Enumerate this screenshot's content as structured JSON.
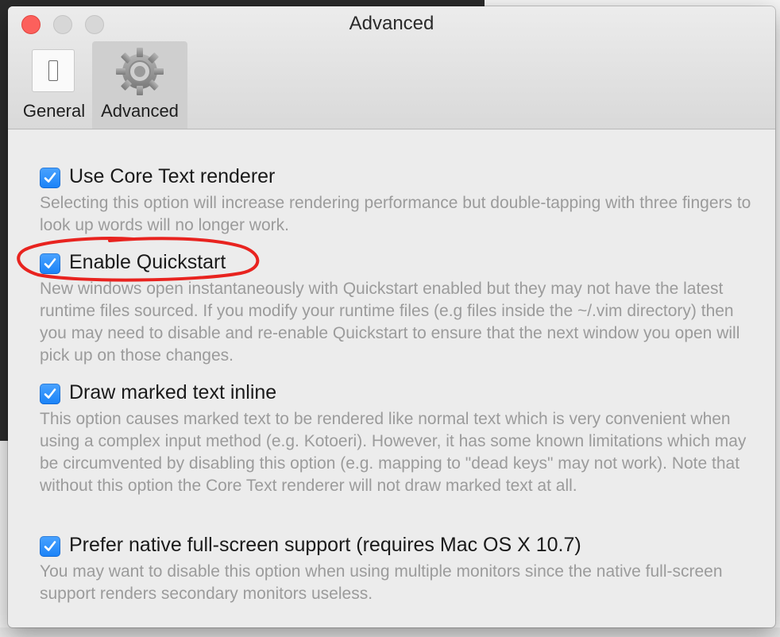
{
  "window": {
    "title": "Advanced"
  },
  "toolbar": {
    "items": [
      {
        "label": "General",
        "icon": "general-switch-icon",
        "selected": false
      },
      {
        "label": "Advanced",
        "icon": "gear-icon",
        "selected": true
      }
    ]
  },
  "options": [
    {
      "label": "Use Core Text renderer",
      "checked": true,
      "description": "Selecting this option will increase rendering performance but double-tapping with three fingers to look up words will no longer work."
    },
    {
      "label": "Enable Quickstart",
      "checked": true,
      "description": "New windows open instantaneously with Quickstart enabled but they may not have the latest runtime files sourced.  If you modify your runtime files (e.g files inside the ~/.vim directory) then you may need to disable and re-enable Quickstart to ensure that the next window you open will pick up on those changes."
    },
    {
      "label": "Draw marked text inline",
      "checked": true,
      "description": "This option causes marked text to be rendered like normal text which is very convenient when using a complex input method (e.g. Kotoeri). However, it has some known limitations which may be circumvented by disabling this option (e.g. mapping to \"dead keys\" may not work). Note that without this option the Core Text renderer will not draw marked text at all."
    },
    {
      "label": "Prefer native full-screen support (requires Mac OS X 10.7)",
      "checked": true,
      "description": "You may want to disable this option when using multiple monitors since the native full-screen support renders secondary monitors useless."
    }
  ],
  "colors": {
    "accent": "#1a82f7",
    "annotation": "#e8231f",
    "close": "#fc605c"
  }
}
